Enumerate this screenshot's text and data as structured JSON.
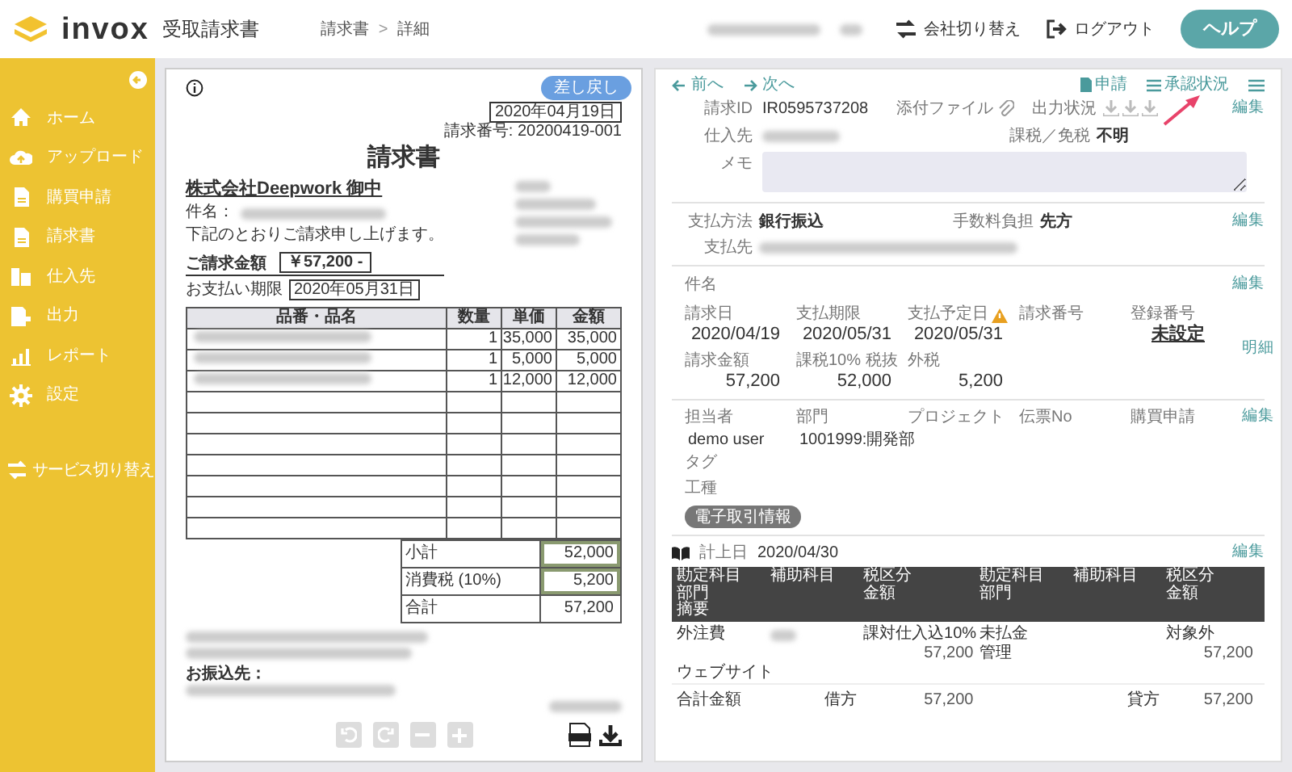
{
  "header": {
    "logo_text": "invox",
    "product": "受取請求書",
    "breadcrumb": [
      "請求書",
      "詳細"
    ],
    "breadcrumb_separator": ">",
    "company_switch": "会社切り替え",
    "logout": "ログアウト",
    "help": "ヘルプ"
  },
  "sidebar": {
    "items": [
      {
        "label": "ホーム",
        "kind": "home"
      },
      {
        "label": "アップロード",
        "kind": "upload"
      },
      {
        "label": "購買申請",
        "kind": "file"
      },
      {
        "label": "請求書",
        "kind": "file"
      },
      {
        "label": "仕入先",
        "kind": "building"
      },
      {
        "label": "出力",
        "kind": "export"
      },
      {
        "label": "レポート",
        "kind": "chart"
      },
      {
        "label": "設定",
        "kind": "gear"
      }
    ],
    "service_switch": "サービス切り替え"
  },
  "document": {
    "return_button": "差し戻し",
    "date": "2020年04月19日",
    "number": "請求番号: 20200419-001",
    "title": "請求書",
    "recipient": "株式会社Deepwork 御中",
    "subject_label": "件名：",
    "intro": "下記のとおりご請求申し上げます。",
    "amount_label": "ご請求金額",
    "amount": "￥57,200 -",
    "due_label": "お支払い期限",
    "due": "2020年05月31日",
    "columns": [
      "品番・品名",
      "数量",
      "単価",
      "金額"
    ],
    "rows": [
      {
        "quantity": "1",
        "unit_price": "35,000",
        "amount": "35,000"
      },
      {
        "quantity": "1",
        "unit_price": "5,000",
        "amount": "5,000"
      },
      {
        "quantity": "1",
        "unit_price": "12,000",
        "amount": "12,000"
      }
    ],
    "totals": [
      {
        "label": "小計",
        "value": "52,000",
        "boxed": true
      },
      {
        "label": "消費税 (10%)",
        "value": "5,200",
        "boxed": true
      },
      {
        "label": "合計",
        "value": "57,200",
        "boxed": false
      }
    ],
    "bank_label": "お振込先："
  },
  "detail": {
    "nav": {
      "prev": "前へ",
      "next": "次へ",
      "apply": "申請",
      "approval": "承認状況"
    },
    "details_link": "明細",
    "basic": {
      "invoice_id_label": "請求ID",
      "invoice_id": "IR0595737208",
      "attachment_label": "添付ファイル",
      "output_label": "出力状況",
      "edit": "編集",
      "supplier_label": "仕入先",
      "tax_label": "課税／免税",
      "tax_value": "不明",
      "memo_label": "メモ"
    },
    "payment": {
      "method_label": "支払方法",
      "method": "銀行振込",
      "fee_label": "手数料負担",
      "fee": "先方",
      "edit": "編集",
      "payee_label": "支払先"
    },
    "subject_label": "件名",
    "subject_edit": "編集",
    "amounts": [
      {
        "label": "請求日",
        "value": "2020/04/19",
        "kind": "value"
      },
      {
        "label": "支払期限",
        "value": "2020/05/31",
        "kind": "value"
      },
      {
        "label": "支払予定日",
        "value": "2020/05/31",
        "kind": "value",
        "warning": true
      },
      {
        "label": "請求番号",
        "kind": "value"
      },
      {
        "label": "登録番号",
        "value": "未設定",
        "kind": "link"
      },
      {
        "label": "請求金額",
        "value": "57,200",
        "kind": "value"
      },
      {
        "label": "課税10% 税抜",
        "value": "52,000",
        "kind": "value"
      },
      {
        "label": "外税",
        "value": "5,200",
        "kind": "value"
      }
    ],
    "assign_edit": "編集",
    "assign": [
      {
        "label": "担当者",
        "value": "demo user"
      },
      {
        "label": "部門",
        "value": "1001999:開発部"
      },
      {
        "label": "プロジェクト"
      },
      {
        "label": "伝票No"
      },
      {
        "label": "購買申請"
      }
    ],
    "tag_label": "タグ",
    "work_label": "工種",
    "e_trade_button": "電子取引情報",
    "journal": {
      "date_label": "計上日",
      "date": "2020/04/30",
      "edit": "編集",
      "columns": [
        [
          "勘定科目",
          "部門",
          "摘要"
        ],
        [
          "補助科目"
        ],
        [
          "税区分",
          "金額"
        ],
        [
          "勘定科目",
          "部門"
        ],
        [
          "補助科目"
        ],
        [
          "税区分",
          "金額"
        ]
      ],
      "row": {
        "debit_account": [
          "外注費"
        ],
        "debit_tax": [
          "課対仕入込10%",
          "57,200"
        ],
        "credit_account": [
          "未払金",
          "管理"
        ],
        "credit_tax": [
          "対象外",
          "57,200"
        ]
      },
      "memo": "ウェブサイト",
      "total_label": "合計金額",
      "debit_label": "借方",
      "debit": "57,200",
      "credit_label": "貸方",
      "credit": "57,200"
    }
  }
}
